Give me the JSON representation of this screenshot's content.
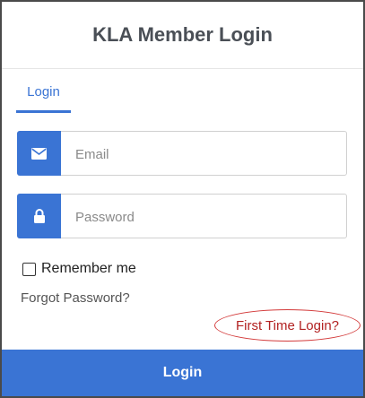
{
  "header": {
    "title": "KLA Member Login"
  },
  "tabs": [
    {
      "label": "Login",
      "active": true
    }
  ],
  "form": {
    "email": {
      "placeholder": "Email",
      "value": "",
      "icon": "envelope-icon"
    },
    "password": {
      "placeholder": "Password",
      "value": "",
      "icon": "lock-icon"
    },
    "remember_label": "Remember me",
    "remember_checked": false,
    "forgot_label": "Forgot Password?",
    "first_time_label": "First Time Login?",
    "submit_label": "Login"
  },
  "colors": {
    "accent": "#3a74d4",
    "title_text": "#4a4f56",
    "annotation_red": "#d33a3a"
  }
}
